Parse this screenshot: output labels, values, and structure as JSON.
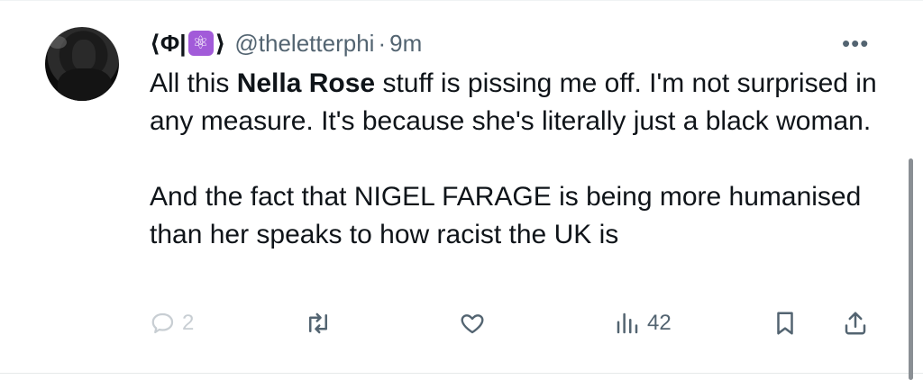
{
  "tweet": {
    "display_name_prefix": "⟨Φ|",
    "display_name_emoji": "⚛",
    "display_name_suffix": "⟩",
    "handle": "@theletterphi",
    "separator": "·",
    "time": "9m",
    "text_line1_pre": "All this ",
    "text_line1_bold": "Nella Rose",
    "text_line1_post": " stuff is pissing me off. I'm not surprised in any measure. It's because she's literally just a black woman.",
    "text_paragraph2": "And the fact that NIGEL FARAGE is being more humanised than her speaks to how racist the UK is"
  },
  "actions": {
    "reply_count": "2",
    "retweet_count": "",
    "like_count": "",
    "views_count": "42"
  },
  "icons": {
    "more": "more-options-icon",
    "reply": "reply-icon",
    "retweet": "retweet-icon",
    "like": "heart-icon",
    "views": "views-icon",
    "bookmark": "bookmark-icon",
    "share": "share-icon"
  },
  "colors": {
    "text_primary": "#0f1419",
    "text_secondary": "#536471",
    "emoji_bg": "#a25bd9"
  }
}
